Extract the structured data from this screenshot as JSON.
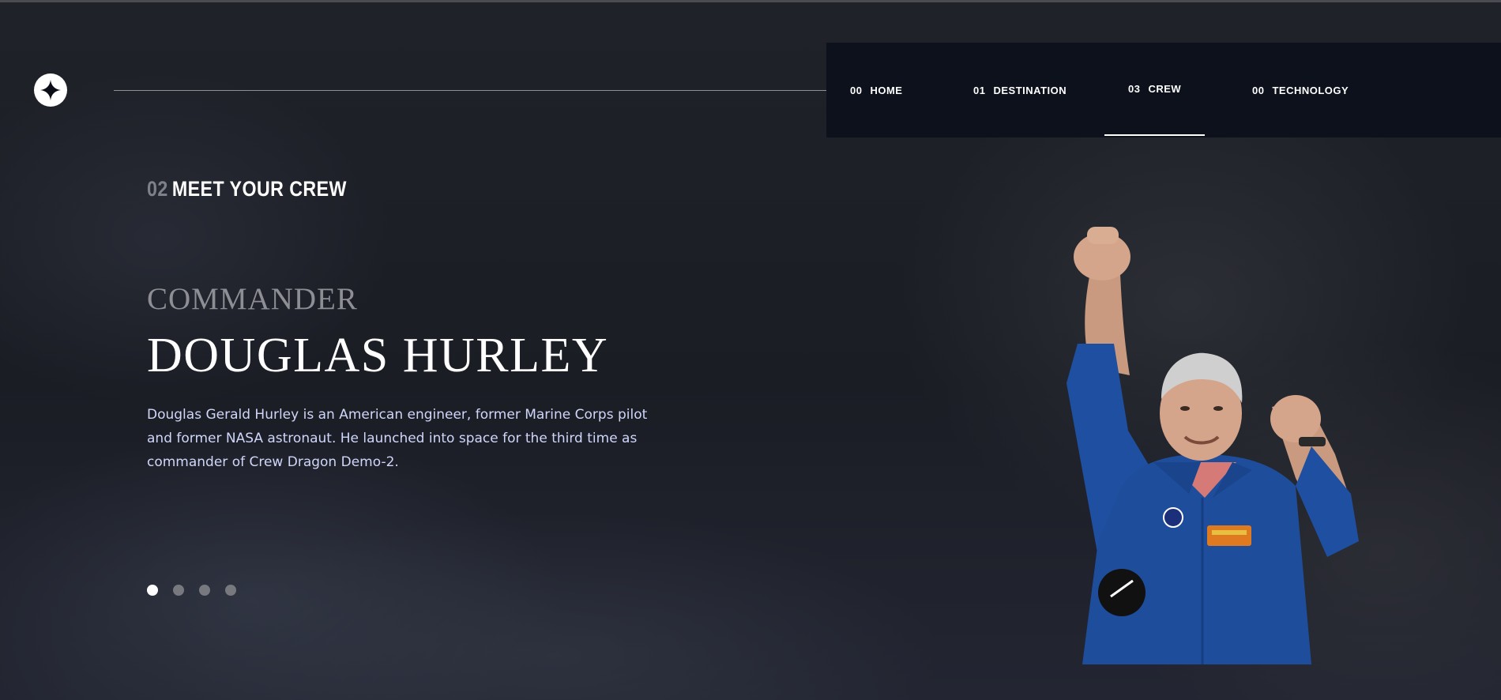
{
  "nav": {
    "items": [
      {
        "num": "00",
        "label": "HOME"
      },
      {
        "num": "01",
        "label": "DESTINATION"
      },
      {
        "num": "03",
        "label": "CREW"
      },
      {
        "num": "00",
        "label": "TECHNOLOGY"
      }
    ],
    "active": "CREW"
  },
  "header": {
    "eyebrow_num": "02",
    "eyebrow_text": "MEET YOUR CREW"
  },
  "crew": {
    "role": "COMMANDER",
    "name": "DOUGLAS HURLEY",
    "bio": "Douglas Gerald Hurley is an American engineer, former Marine Corps pilot and former NASA astronaut. He launched into space for the third time as commander of Crew Dragon Demo-2.",
    "image_alt": "Douglas Hurley"
  },
  "carousel": {
    "count": 4,
    "active_index": 0
  },
  "icons": {
    "logo": "star-logo-icon"
  },
  "colors": {
    "background": "#1d1f26",
    "nav_background": "#0d111b",
    "text_primary": "#ffffff",
    "text_muted": "#8d8f94",
    "bio_text": "#d0d6f9",
    "suit_blue": "#1f4fa0"
  }
}
